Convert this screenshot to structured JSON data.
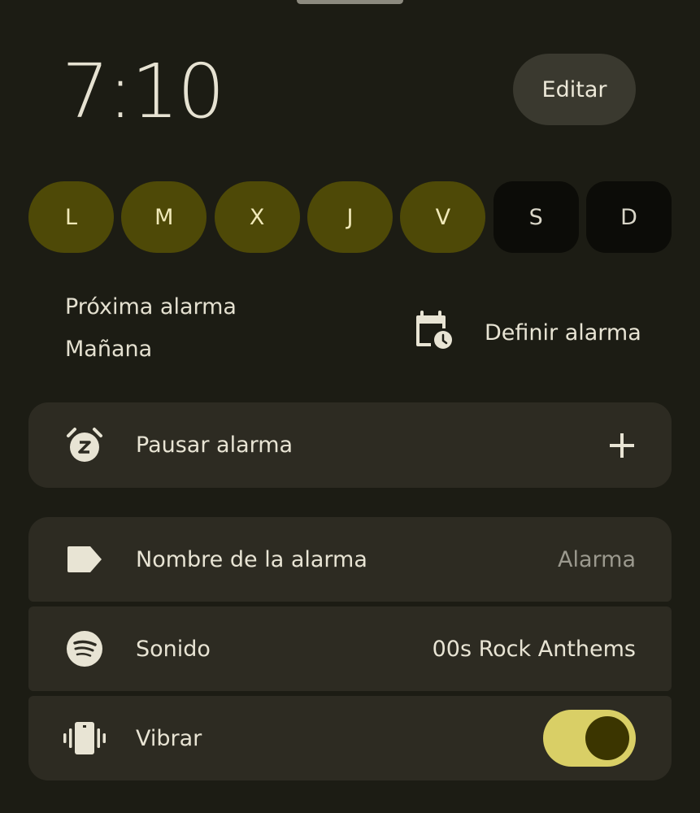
{
  "alarm": {
    "time": "7:10",
    "edit_label": "Editar"
  },
  "days": [
    {
      "label": "L",
      "active": true
    },
    {
      "label": "M",
      "active": true
    },
    {
      "label": "X",
      "active": true
    },
    {
      "label": "J",
      "active": true
    },
    {
      "label": "V",
      "active": true
    },
    {
      "label": "S",
      "active": false
    },
    {
      "label": "D",
      "active": false
    }
  ],
  "next_alarm": {
    "label": "Próxima alarma",
    "value": "Mañana",
    "set_label": "Definir alarma"
  },
  "snooze": {
    "label": "Pausar alarma",
    "icon": "snooze-alarm-icon"
  },
  "settings": {
    "name": {
      "label": "Nombre de la alarma",
      "value": "Alarma",
      "icon": "label-tag-icon"
    },
    "sound": {
      "label": "Sonido",
      "value": "00s Rock Anthems",
      "icon": "spotify-icon"
    },
    "vibrate": {
      "label": "Vibrar",
      "enabled": true,
      "icon": "vibrate-phone-icon"
    }
  },
  "colors": {
    "background": "#1c1c14",
    "card": "#2d2b22",
    "day_active": "#4e4907",
    "day_inactive": "#0c0c08",
    "toggle_track": "#d9cf66",
    "toggle_knob": "#3b3500"
  }
}
